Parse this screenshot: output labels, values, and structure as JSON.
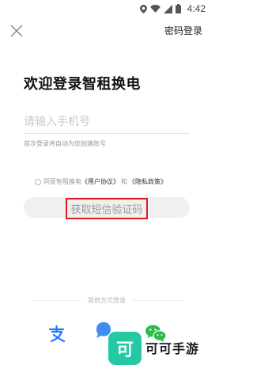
{
  "status_bar": {
    "time": "4:42"
  },
  "header": {
    "password_login_label": "密码登录"
  },
  "title": "欢迎登录智租换电",
  "phone_input": {
    "placeholder": "请输入手机号",
    "value": ""
  },
  "hint": "首次登录将自动为您创建账号",
  "agreement": {
    "prefix": "同意智租换电",
    "user_agreement": "《用户协议》",
    "and": "和",
    "privacy_policy": "《隐私政策》",
    "checked": false
  },
  "sms_button_label": "获取短信验证码",
  "other_login": {
    "label": "其他方式登录",
    "icons": [
      "alipay-icon",
      "chat-bubble-icon",
      "wechat-icon"
    ]
  },
  "watermark": {
    "badge_glyph": "可",
    "text": "可可手游"
  },
  "colors": {
    "highlight_box": "#e0191f",
    "alipay": "#1678ff",
    "bubble": "#3d8cf0",
    "wechat": "#2dbb4e",
    "watermark_badge": "#22c9a3"
  }
}
